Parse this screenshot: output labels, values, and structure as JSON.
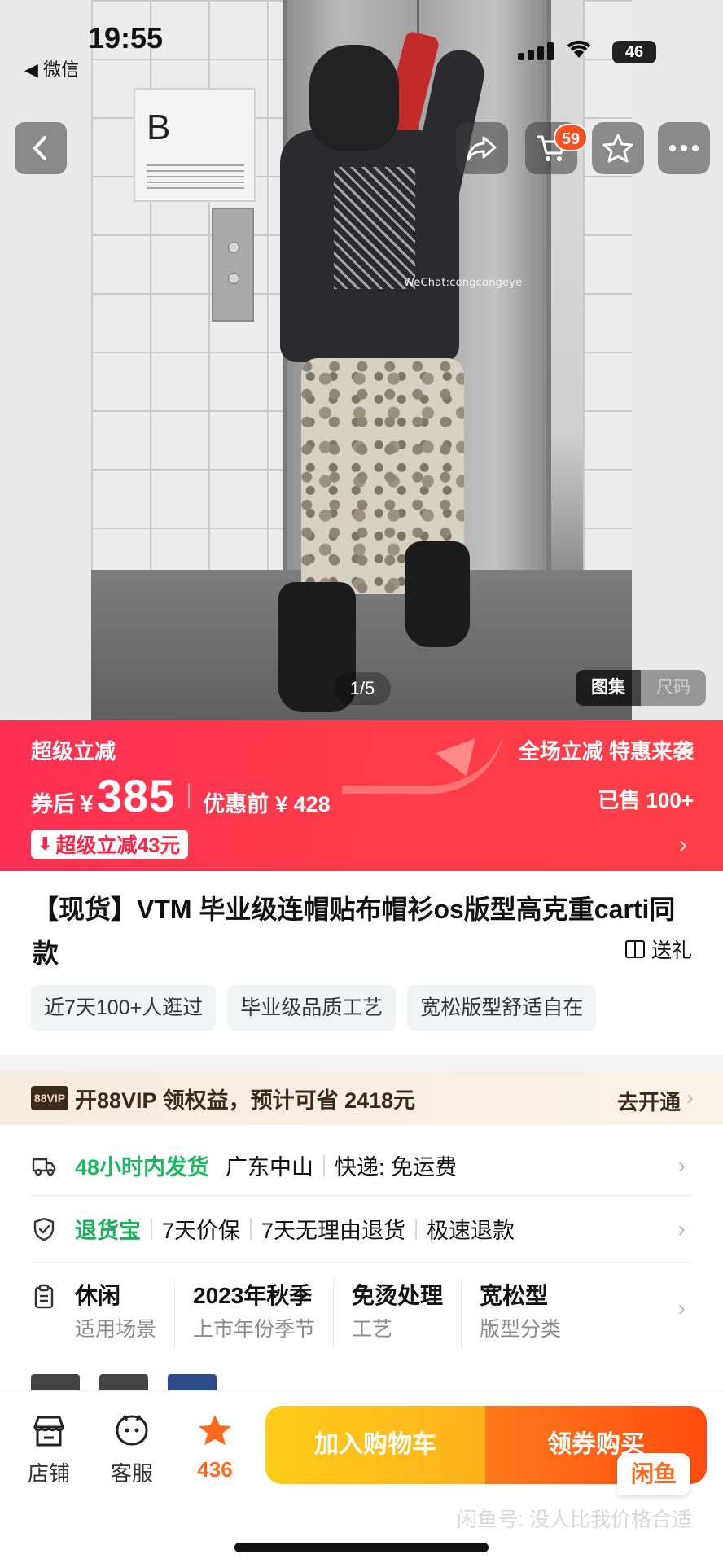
{
  "status_bar": {
    "time": "19:55",
    "back_app": "◀ 微信",
    "network": "46"
  },
  "top_actions": {
    "cart_badge": "59"
  },
  "gallery": {
    "counter": "1/5",
    "tab_gallery": "图集",
    "tab_size": "尺码",
    "watermark": "WeChat:congcongeye"
  },
  "promo": {
    "title": "超级立减",
    "price_prefix": "券后",
    "currency": "¥",
    "price": "385",
    "before_label": "优惠前",
    "before_price": "¥ 428",
    "tagline": "全场立减 特惠来袭",
    "sold": "已售 100+",
    "discount_tag": "超级立减43元"
  },
  "product": {
    "title": "【现货】VTM 毕业级连帽贴布帽衫os版型高克重carti同款",
    "gift_label": "送礼",
    "chips": [
      "近7天100+人逛过",
      "毕业级品质工艺",
      "宽松版型舒适自在"
    ]
  },
  "vip": {
    "badge": "88VIP",
    "text": "开88VIP 领权益，预计可省 2418元",
    "action": "去开通"
  },
  "shipping": {
    "time": "48小时内发货",
    "location": "广东中山",
    "delivery": "快递: 免运费"
  },
  "returns": {
    "label": "退货宝",
    "items": [
      "7天价保",
      "7天无理由退货",
      "极速退款"
    ]
  },
  "attributes": [
    {
      "value": "休闲",
      "key": "适用场景"
    },
    {
      "value": "2023年秋季",
      "key": "上市年份季节"
    },
    {
      "value": "免烫处理",
      "key": "工艺"
    },
    {
      "value": "宽松型",
      "key": "版型分类"
    }
  ],
  "bottom_bar": {
    "shop": "店铺",
    "service": "客服",
    "fav_count": "436",
    "add_cart": "加入购物车",
    "buy": "领券购买",
    "xianyu_logo": "闲鱼",
    "xianyu_watermark": "闲鱼号: 没人比我价格合适"
  },
  "colors": {
    "promo_red": "#ff3b4a",
    "accent_orange": "#ff6a1f",
    "green": "#1fb964",
    "cart_yellow": "#ffc21a"
  }
}
